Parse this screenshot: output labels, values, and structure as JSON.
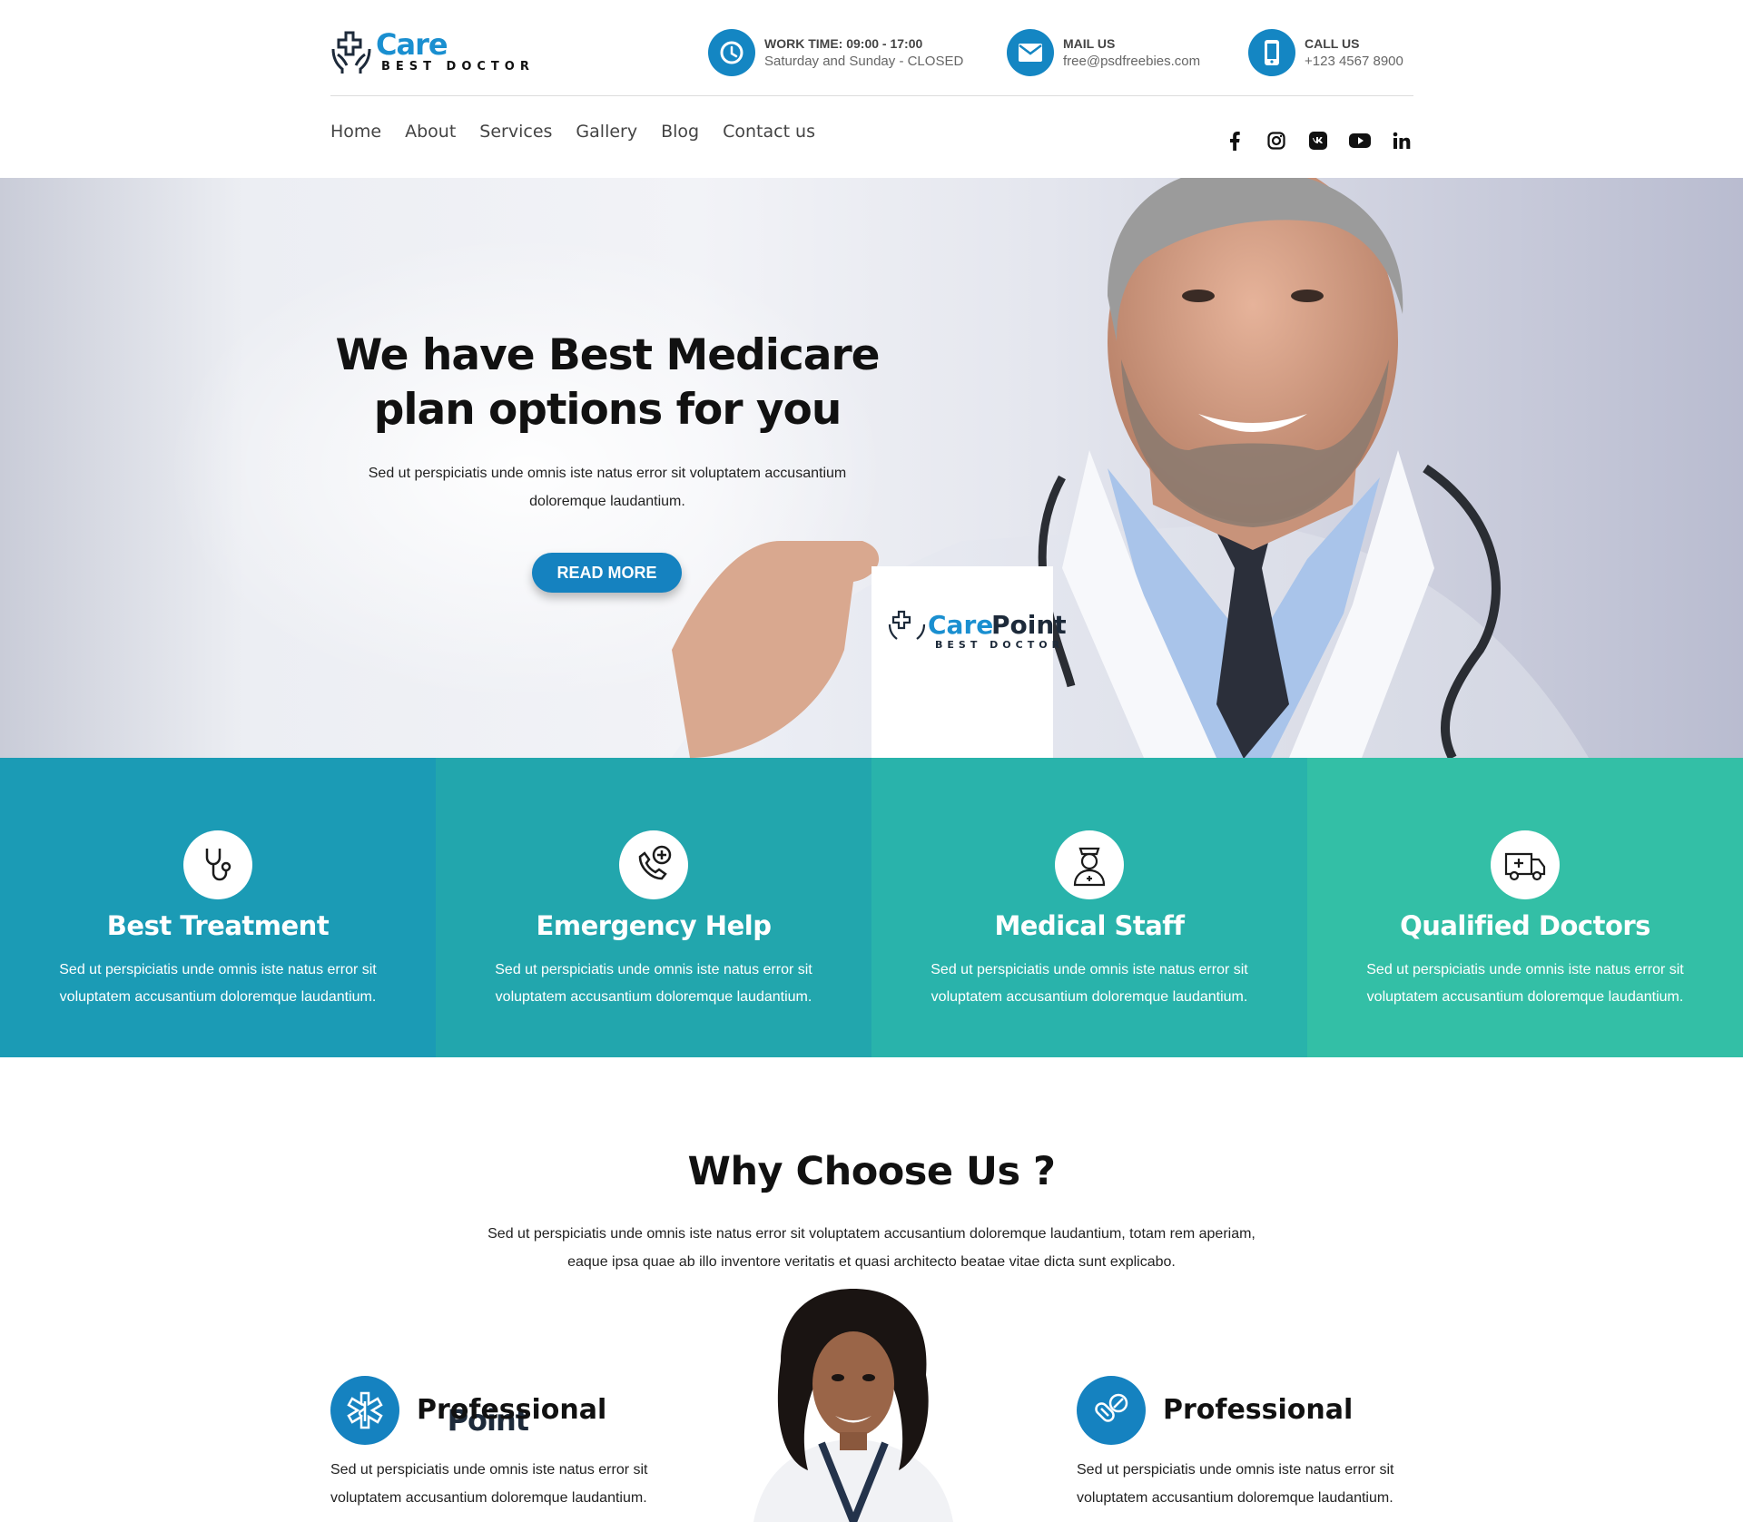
{
  "brand": {
    "name_part1": "Care",
    "name_part2": "Point",
    "tagline": "BEST DOCTOR"
  },
  "header": {
    "work": {
      "label": "WORK TIME: 09:00 - 17:00",
      "value": "Saturday and Sunday - CLOSED",
      "icon": "clock-icon"
    },
    "mail": {
      "label": "MAIL US",
      "value": "free@psdfreebies.com",
      "icon": "envelope-icon"
    },
    "call": {
      "label": "CALL US",
      "value": "+123 4567 8900",
      "icon": "phone-icon"
    }
  },
  "nav": {
    "items": [
      "Home",
      "About",
      "Services",
      "Gallery",
      "Blog",
      "Contact us"
    ]
  },
  "social": [
    "facebook-icon",
    "instagram-icon",
    "vk-icon",
    "youtube-icon",
    "linkedin-icon"
  ],
  "hero": {
    "title": "We have Best Medicare plan options for you",
    "text": "Sed ut perspiciatis unde omnis iste natus error sit voluptatem accusantium doloremque laudantium.",
    "button": "READ MORE"
  },
  "features": [
    {
      "title": "Best Treatment",
      "text": "Sed ut perspiciatis unde omnis iste natus error sit voluptatem accusantium doloremque laudantium.",
      "color": "#1b9bb5",
      "icon": "stethoscope-icon"
    },
    {
      "title": "Emergency Help",
      "text": "Sed ut perspiciatis unde omnis iste natus error sit voluptatem accusantium doloremque laudantium.",
      "color": "#22a6ad",
      "icon": "phone-medical-icon"
    },
    {
      "title": "Medical Staff",
      "text": "Sed ut perspiciatis unde omnis iste natus error sit voluptatem accusantium doloremque laudantium.",
      "color": "#29b3ab",
      "icon": "nurse-icon"
    },
    {
      "title": "Qualified Doctors",
      "text": "Sed ut perspiciatis unde omnis iste natus error sit voluptatem accusantium doloremque laudantium.",
      "color": "#33bfa6",
      "icon": "ambulance-icon"
    }
  ],
  "why": {
    "title": "Why Choose Us ?",
    "text": "Sed ut perspiciatis unde omnis iste natus error sit voluptatem accusantium doloremque laudantium, totam rem aperiam, eaque ipsa quae ab illo inventore veritatis et quasi architecto beatae vitae dicta sunt explicabo.",
    "points": [
      {
        "title": "Professional",
        "text": "Sed ut perspiciatis unde omnis iste natus error sit voluptatem accusantium doloremque laudantium.",
        "icon": "star-of-life-icon"
      },
      {
        "title": "Professional",
        "text": "Sed ut perspiciatis unde omnis iste natus error sit voluptatem accusantium doloremque laudantium.",
        "icon": "pills-icon"
      }
    ]
  },
  "colors": {
    "primary": "#1582c0",
    "dark": "#1d2a3a"
  }
}
